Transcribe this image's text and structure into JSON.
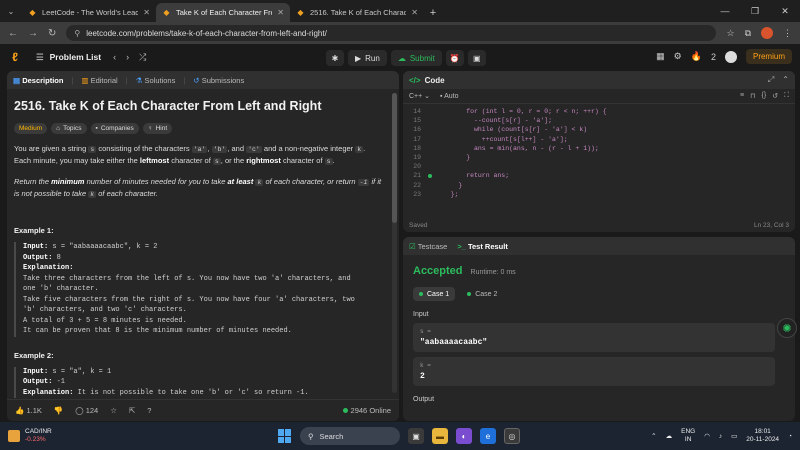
{
  "browser": {
    "tabs": [
      {
        "title": "LeetCode - The World's Leadin",
        "active": false
      },
      {
        "title": "Take K of Each Character From",
        "active": true
      },
      {
        "title": "2516. Take K of Each Character",
        "active": false
      }
    ],
    "url": "leetcode.com/problems/take-k-of-each-character-from-left-and-right/"
  },
  "header": {
    "problem_list": "Problem List",
    "run": "Run",
    "submit": "Submit",
    "fire_count": "2",
    "premium": "Premium"
  },
  "left": {
    "tabs": [
      "Description",
      "Editorial",
      "Solutions",
      "Submissions"
    ],
    "title": "2516. Take K of Each Character From Left and Right",
    "chips": [
      "Medium",
      "Topics",
      "Companies",
      "Hint"
    ],
    "p1": {
      "a": "You are given a string",
      "s": "s",
      "b": "consisting of the characters",
      "c1": "'a'",
      "c2": "'b'",
      "and": ", and",
      "c3": "'c'",
      "d": "and a non-negative integer",
      "k": "k",
      "e": ". Each minute, you may take either the",
      "leftmost": "leftmost",
      "f": "character of",
      "g": ", or the",
      "rightmost": "rightmost",
      "h": "character of",
      "end": "."
    },
    "p2": {
      "a": "Return the",
      "minimum": "minimum",
      "b": "number of minutes needed for you to take",
      "atleast": "at least",
      "c": "of each character, or return",
      "neg": "-1",
      "d": "if it is not possible to take",
      "e": "of each character."
    },
    "example1": {
      "heading": "Example 1:",
      "input_label": "Input:",
      "input": "s = \"aabaaaacaabc\", k = 2",
      "output_label": "Output:",
      "output": "8",
      "expl_label": "Explanation:",
      "lines": [
        "Take three characters from the left of s. You now have two 'a' characters, and",
        "one 'b' character.",
        "Take five characters from the right of s. You now have four 'a' characters, two",
        "'b' characters, and two 'c' characters.",
        "A total of 3 + 5 = 8 minutes is needed.",
        "It can be proven that 8 is the minimum number of minutes needed."
      ]
    },
    "example2": {
      "heading": "Example 2:",
      "input_label": "Input:",
      "input": "s = \"a\", k = 1",
      "output_label": "Output:",
      "output": "-1",
      "expl_label": "Explanation:",
      "expl": "It is not possible to take one 'b' or 'c' so return -1."
    },
    "footer": {
      "likes": "1.1K",
      "comments": "124",
      "online": "2946 Online"
    }
  },
  "code": {
    "title": "Code",
    "lang": "C++",
    "mode": "Auto",
    "lines": [
      {
        "n": "14",
        "t": "        for (int l = 0, r = 0; r < n; ++r) {"
      },
      {
        "n": "15",
        "t": "          --count[s[r] - 'a'];"
      },
      {
        "n": "16",
        "t": "          while (count[s[r] - 'a'] < k)"
      },
      {
        "n": "17",
        "t": "            ++count[s[l++] - 'a'];"
      },
      {
        "n": "18",
        "t": "          ans = min(ans, n - (r - l + 1));"
      },
      {
        "n": "19",
        "t": "        }"
      },
      {
        "n": "20",
        "t": ""
      },
      {
        "n": "21",
        "t": "        return ans;"
      },
      {
        "n": "22",
        "t": "      }"
      },
      {
        "n": "23",
        "t": "    };"
      }
    ],
    "saved": "Saved",
    "position": "Ln 23, Col 3"
  },
  "result": {
    "tabs": [
      "Testcase",
      "Test Result"
    ],
    "status": "Accepted",
    "runtime": "Runtime: 0 ms",
    "cases": [
      "Case 1",
      "Case 2"
    ],
    "input_label": "Input",
    "inputs": [
      {
        "k": "s =",
        "v": "\"aabaaaacaabc\""
      },
      {
        "k": "k =",
        "v": "2"
      }
    ],
    "output_label": "Output"
  },
  "taskbar": {
    "ticker": "CAD/INR",
    "change": "-0.23%",
    "search": "Search",
    "lang1": "ENG",
    "lang2": "IN",
    "time": "18:01",
    "date": "20-11-2024"
  }
}
